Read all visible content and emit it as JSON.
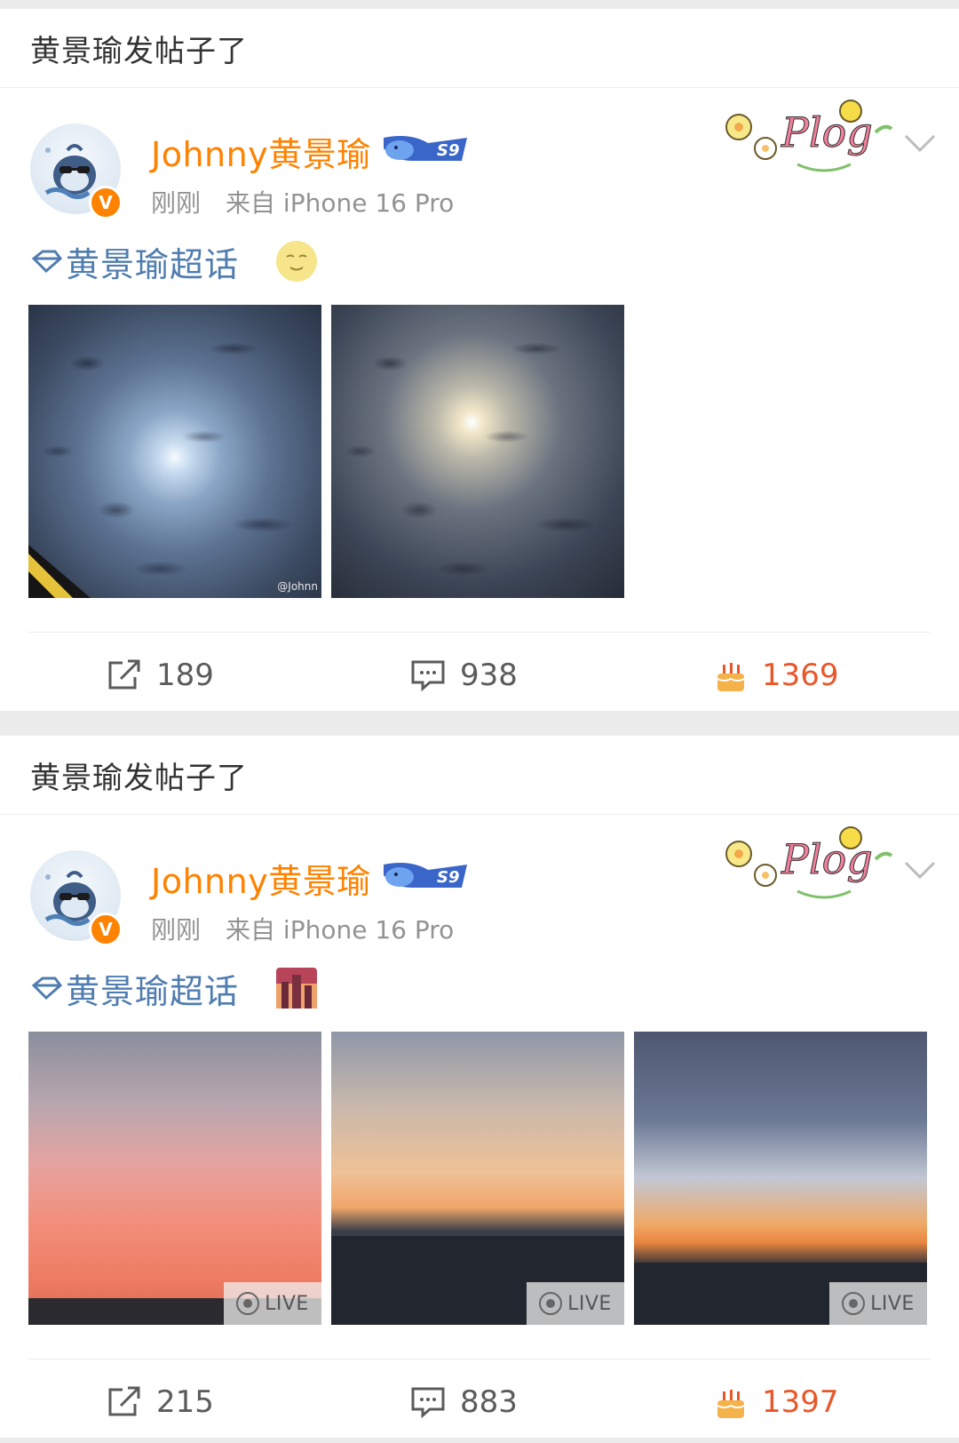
{
  "posts": [
    {
      "header": "黄景瑜发帖子了",
      "user": {
        "name": "Johnny黄景瑜",
        "badge": "S9",
        "verified_mark": "V"
      },
      "meta": {
        "time": "刚刚",
        "source": "来自 iPhone 16 Pro"
      },
      "decor_text": "Plog",
      "topic": "黄景瑜超话",
      "images": [
        {
          "kind": "moon-clouds",
          "watermark": "@Johnn"
        },
        {
          "kind": "moon-clouds"
        }
      ],
      "stats": {
        "reposts": "189",
        "comments": "938",
        "likes": "1369"
      }
    },
    {
      "header": "黄景瑜发帖子了",
      "user": {
        "name": "Johnny黄景瑜",
        "badge": "S9",
        "verified_mark": "V"
      },
      "meta": {
        "time": "刚刚",
        "source": "来自 iPhone 16 Pro"
      },
      "decor_text": "Plog",
      "topic": "黄景瑜超话",
      "images": [
        {
          "kind": "sunset",
          "live": "LIVE"
        },
        {
          "kind": "sunset",
          "live": "LIVE"
        },
        {
          "kind": "sunset",
          "live": "LIVE"
        }
      ],
      "stats": {
        "reposts": "215",
        "comments": "883",
        "likes": "1397"
      }
    }
  ],
  "colors": {
    "username": "#ff8200",
    "topic": "#507daf",
    "like": "#e8572a",
    "meta": "#939393"
  },
  "icons": [
    "repost-icon",
    "comment-icon",
    "like-cake-icon",
    "chevron-down-icon",
    "diamond-icon",
    "smile-moon-emoji",
    "cityscape-emoji"
  ]
}
